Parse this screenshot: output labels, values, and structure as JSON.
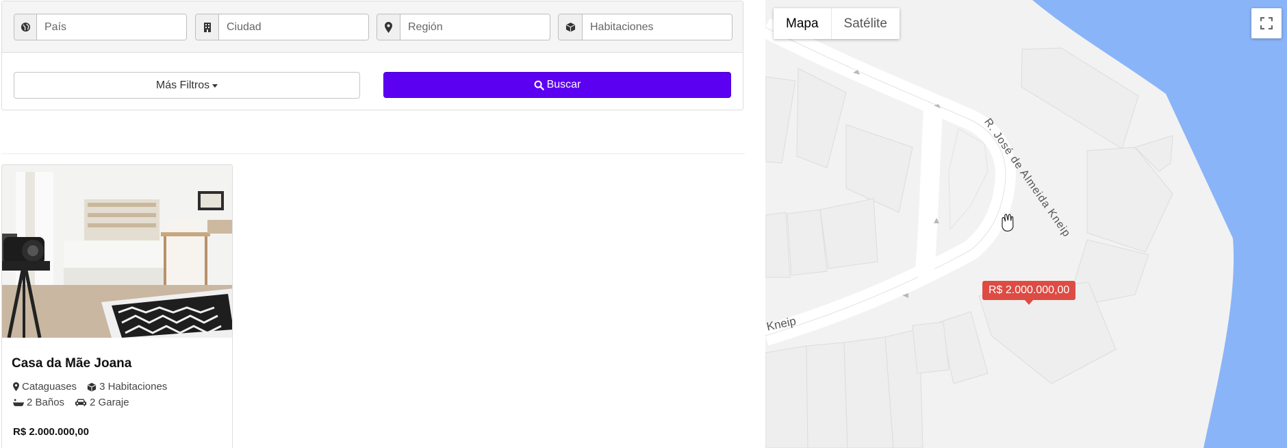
{
  "filters": {
    "country_placeholder": "País",
    "city_placeholder": "Ciudad",
    "region_placeholder": "Región",
    "rooms_placeholder": "Habitaciones",
    "more_filters_label": "Más Filtros",
    "search_label": "Buscar"
  },
  "listing": {
    "title": "Casa da Mãe Joana",
    "city": "Cataguases",
    "rooms": "3 Habitaciones",
    "baths": "2 Baños",
    "garage": "2 Garaje",
    "price": "R$ 2.000.000,00"
  },
  "map": {
    "type_map_label": "Mapa",
    "type_satellite_label": "Satélite",
    "street_label": "R. José de Almeida Kneip",
    "street_label_partial": "Kneip",
    "marker_price": "R$ 2.000.000,00"
  },
  "colors": {
    "primary": "#5c00f2",
    "marker": "#dd4b43",
    "water": "#8ab4f8"
  }
}
